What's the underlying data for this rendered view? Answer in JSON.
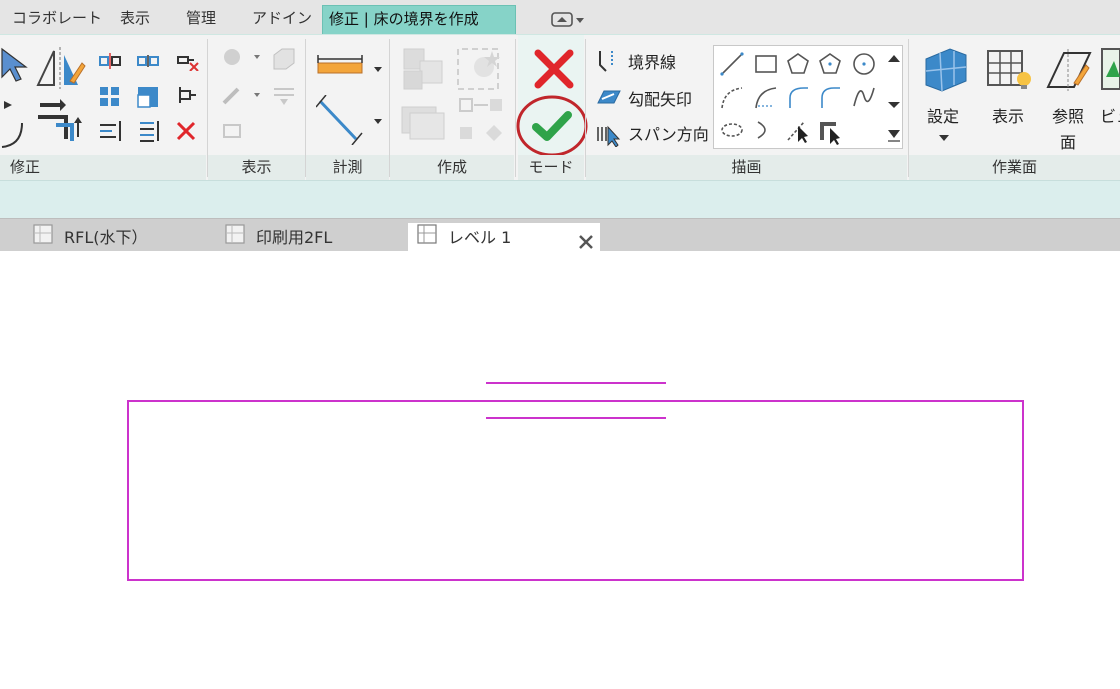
{
  "menu_tabs": [
    "コラボレート",
    "表示",
    "管理",
    "アドイン",
    "修正 | 床の境界を作成"
  ],
  "panels": {
    "modify": "修正",
    "view": "表示",
    "measure": "計測",
    "create": "作成",
    "mode": "モード",
    "draw": "描画",
    "workplane": "作業面"
  },
  "draw_tools": {
    "boundary_line": "境界線",
    "slope_arrow": "勾配矢印",
    "span_direction": "スパン方向"
  },
  "workplane_tools": {
    "set": "設定",
    "show": "表示",
    "ref_plane_1": "参照",
    "ref_plane_2": "面",
    "viewer": "ビュ"
  },
  "view_tabs": [
    "RFL(水下）",
    "印刷用2FL",
    "レベル 1"
  ],
  "colors": {
    "sketch": "#cc33cc",
    "active_tab": "#86d3c8",
    "finish_check": "#2fa34a",
    "cancel_x": "#e0262b",
    "highlight_circle": "#c0262b"
  }
}
